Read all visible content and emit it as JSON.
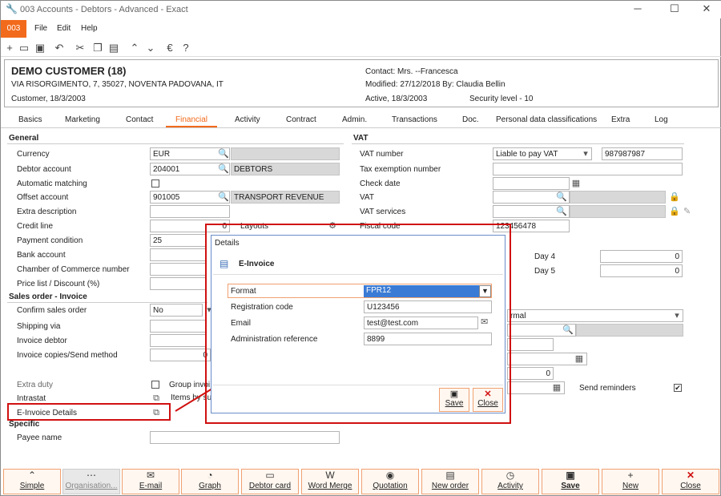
{
  "window": {
    "title": "003 Accounts - Debtors - Advanced - Exact",
    "minimize": "─",
    "maximize": "☐",
    "close": "✕"
  },
  "menu": {
    "app": "003",
    "items": [
      "File",
      "Edit",
      "Help"
    ]
  },
  "toolbar": {
    "icons": [
      "add-icon",
      "open-icon",
      "save-icon",
      "undo-icon",
      "cut-icon",
      "copy-icon",
      "paste-icon",
      "up-icon",
      "down-icon",
      "euro-icon",
      "help-icon"
    ]
  },
  "header": {
    "name": "DEMO CUSTOMER (18)",
    "address": "VIA RISORGIMENTO, 7, 35027, NOVENTA PADOVANA, IT",
    "customer": "Customer, 18/3/2003",
    "contact": "Contact: Mrs. --Francesca",
    "modified": "Modified: 27/12/2018  By: Claudia Bellin",
    "active": "Active, 18/3/2003",
    "security": "Security level - 10"
  },
  "tabs": [
    "Basics",
    "Marketing",
    "Contact",
    "Financial",
    "Activity",
    "Contract",
    "Admin.",
    "Transactions",
    "Doc.",
    "Personal data classifications",
    "Extra",
    "Log"
  ],
  "active_tab": "Financial",
  "general": {
    "title": "General",
    "currency_label": "Currency",
    "currency": "EUR",
    "debtor_label": "Debtor account",
    "debtor": "204001",
    "debtor_desc": "DEBTORS",
    "automatch_label": "Automatic matching",
    "offset_label": "Offset account",
    "offset": "901005",
    "offset_desc": "TRANSPORT REVENUE",
    "extra_desc_label": "Extra description",
    "credit_label": "Credit line",
    "credit": "0",
    "layouts_label": "Layouts",
    "payment_label": "Payment condition",
    "payment": "25",
    "bank_label": "Bank account",
    "chamber_label": "Chamber of Commerce number",
    "price_label": "Price list / Discount (%)"
  },
  "sales": {
    "title": "Sales order - Invoice",
    "confirm_label": "Confirm sales order",
    "confirm": "No",
    "shipping_label": "Shipping via",
    "invoice_debtor_label": "Invoice debtor",
    "copies_label": "Invoice copies/Send method",
    "copies": "0",
    "extra_duty_label": "Extra duty",
    "group_label": "Group invoi",
    "intrastat_label": "Intrastat",
    "items_label": "Items by su",
    "einvoice_label": "E-Invoice Details"
  },
  "specific": {
    "title": "Specific",
    "payee_label": "Payee name"
  },
  "vat": {
    "title": "VAT",
    "number_label": "VAT number",
    "liable": "Liable to pay VAT",
    "number": "987987987",
    "exemption_label": "Tax exemption number",
    "check_label": "Check date",
    "vat_label": "VAT",
    "services_label": "VAT services",
    "fiscal_label": "Fiscal code",
    "fiscal": "123456478",
    "day4_label": "Day 4",
    "day4": "0",
    "day5_label": "Day 5",
    "day5": "0",
    "normal": "rmal",
    "zero": "0",
    "reminders_label": "Send reminders"
  },
  "dialog": {
    "title": "Details",
    "heading": "E-Invoice",
    "format_label": "Format",
    "format": "FPR12",
    "reg_label": "Registration code",
    "reg": "U123456",
    "email_label": "Email",
    "email": "test@test.com",
    "admin_label": "Administration reference",
    "admin": "8899",
    "save": "Save",
    "close": "Close"
  },
  "footer": [
    "Simple",
    "Organisation...",
    "E-mail",
    "Graph",
    "Debtor card",
    "Word Merge",
    "Quotation",
    "New order",
    "Activity",
    "Save",
    "New",
    "Close"
  ],
  "colors": {
    "accent": "#f26a1b",
    "highlight": "#d01010",
    "select": "#3a7bd5"
  }
}
